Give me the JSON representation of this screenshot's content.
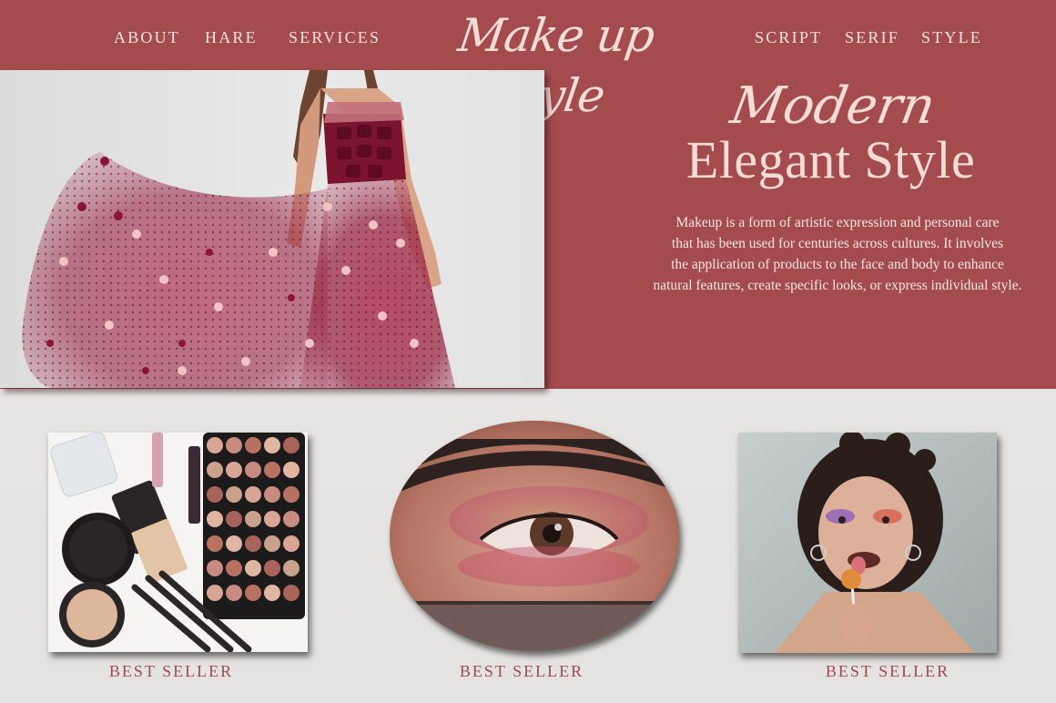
{
  "nav": {
    "left": [
      "ABOUT",
      "HARE",
      "SERVICES"
    ],
    "right": [
      "SCRIPT",
      "SERIF",
      "STYLE"
    ],
    "logo": "Make up Style"
  },
  "hero": {
    "headline_script": "Modern",
    "headline_serif": "Elegant Style",
    "description_lines": [
      "Makeup is a form of artistic expression and personal care",
      "that has been used for centuries across cultures. It involves",
      "the application of products to the face and body to enhance",
      "natural features, create specific looks, or express individual style."
    ]
  },
  "products": [
    {
      "caption": "BEST SELLER"
    },
    {
      "caption": "BEST SELLER"
    },
    {
      "caption": "BEST SELLER"
    }
  ],
  "colors": {
    "brand_band": "#a34b4d",
    "accent_text": "#a04a4c",
    "light_text": "#f7dcd6",
    "background": "#e7e6e4"
  }
}
